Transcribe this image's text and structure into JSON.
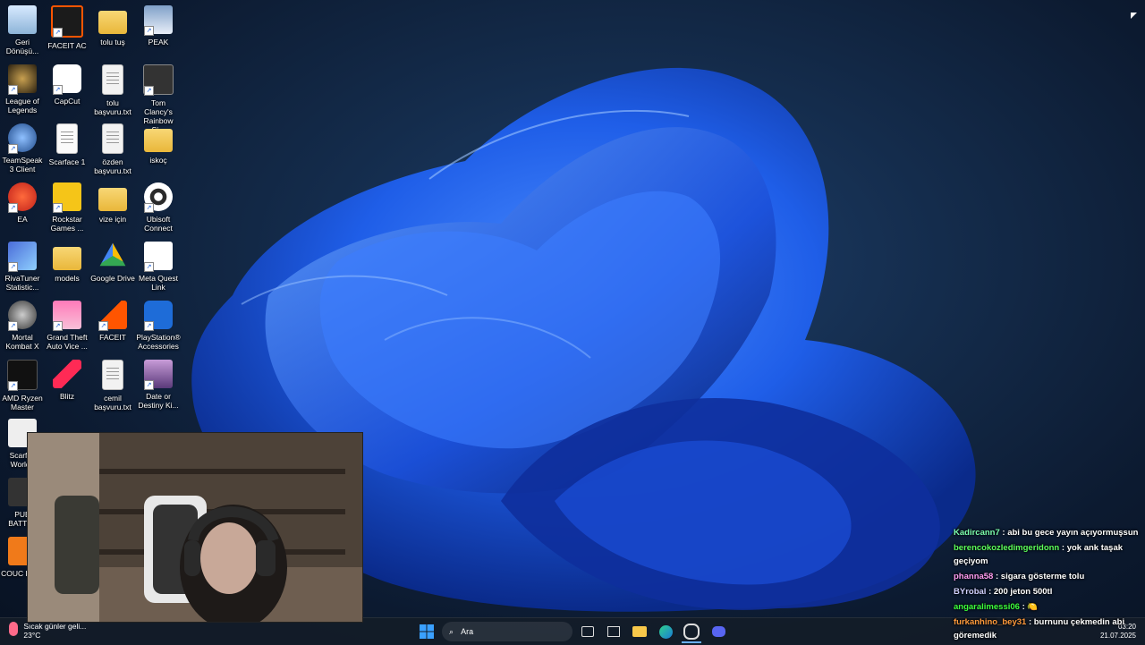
{
  "desktop": {
    "icons": [
      {
        "label": "Geri Dönüşü...",
        "icon": "recycle-bin-icon"
      },
      {
        "label": "FACEIT AC",
        "icon": "faceit-ac-icon"
      },
      {
        "label": "tolu tuş",
        "icon": "folder-icon"
      },
      {
        "label": "PEAK",
        "icon": "peak-icon"
      },
      {
        "label": "League of Legends",
        "icon": "league-icon"
      },
      {
        "label": "CapCut",
        "icon": "capcut-icon"
      },
      {
        "label": "tolu başvuru.txt",
        "icon": "text-file-icon"
      },
      {
        "label": "Tom Clancy's Rainbow Si...",
        "icon": "rainbow-six-icon"
      },
      {
        "label": "TeamSpeak 3 Client",
        "icon": "teamspeak-icon"
      },
      {
        "label": "Scarface 1",
        "icon": "file-icon"
      },
      {
        "label": "özden başvuru.txt",
        "icon": "text-file-icon"
      },
      {
        "label": "iskoç",
        "icon": "folder-icon"
      },
      {
        "label": "EA",
        "icon": "ea-icon"
      },
      {
        "label": "Rockstar Games ...",
        "icon": "rockstar-icon"
      },
      {
        "label": "vize için",
        "icon": "folder-icon"
      },
      {
        "label": "Ubisoft Connect",
        "icon": "ubisoft-icon"
      },
      {
        "label": "RivaTuner Statistic...",
        "icon": "rivatuner-icon"
      },
      {
        "label": "models",
        "icon": "folder-icon"
      },
      {
        "label": "Google Drive",
        "icon": "google-drive-icon"
      },
      {
        "label": "Meta Quest Link",
        "icon": "meta-icon"
      },
      {
        "label": "Mortal Kombat X",
        "icon": "mortal-kombat-icon"
      },
      {
        "label": "Grand Theft Auto Vice ...",
        "icon": "gta-icon"
      },
      {
        "label": "FACEIT",
        "icon": "faceit-icon"
      },
      {
        "label": "PlayStation® Accessories",
        "icon": "playstation-icon"
      },
      {
        "label": "AMD Ryzen Master",
        "icon": "ryzen-icon"
      },
      {
        "label": "Blitz",
        "icon": "blitz-icon"
      },
      {
        "label": "cemil başvuru.txt",
        "icon": "text-file-icon"
      },
      {
        "label": "Date or Destiny Ki...",
        "icon": "date-or-destiny-icon"
      },
      {
        "label": "Scarfac World I",
        "icon": "scarface-world-icon"
      },
      {
        "label": "PUE BATTLE",
        "icon": "pubg-icon"
      },
      {
        "label": "COUC PURI",
        "icon": "cougar-icon"
      }
    ]
  },
  "chat": {
    "messages": [
      {
        "user": "Kadircann7",
        "color": "#7cffb0",
        "text": ": abi bu gece yayın açıyormuşsun"
      },
      {
        "user": "berencokozledimgeridonn",
        "color": "#5cff5c",
        "text": ": yok ank taşak geçiyom"
      },
      {
        "user": "phanna58",
        "color": "#ff9cf0",
        "text": ": sigara gösterme tolu"
      },
      {
        "user": "BYrobal",
        "color": "#d0d0ff",
        "text": ": 200 jeton 500tl"
      },
      {
        "user": "angaralimessi06",
        "color": "#3cff3c",
        "text": ": 🍋"
      },
      {
        "user": "furkanhino_bey31",
        "color": "#ff9a3c",
        "text": ": burnunu çekmedin abi göremedik"
      }
    ]
  },
  "taskbar": {
    "weather_text": "Sıcak günler geli...",
    "weather_temp": "23°C",
    "search_placeholder": "Ara",
    "time": "03:20",
    "date": "21.07.2025",
    "colors": {
      "start": "#3aa0ff"
    }
  }
}
